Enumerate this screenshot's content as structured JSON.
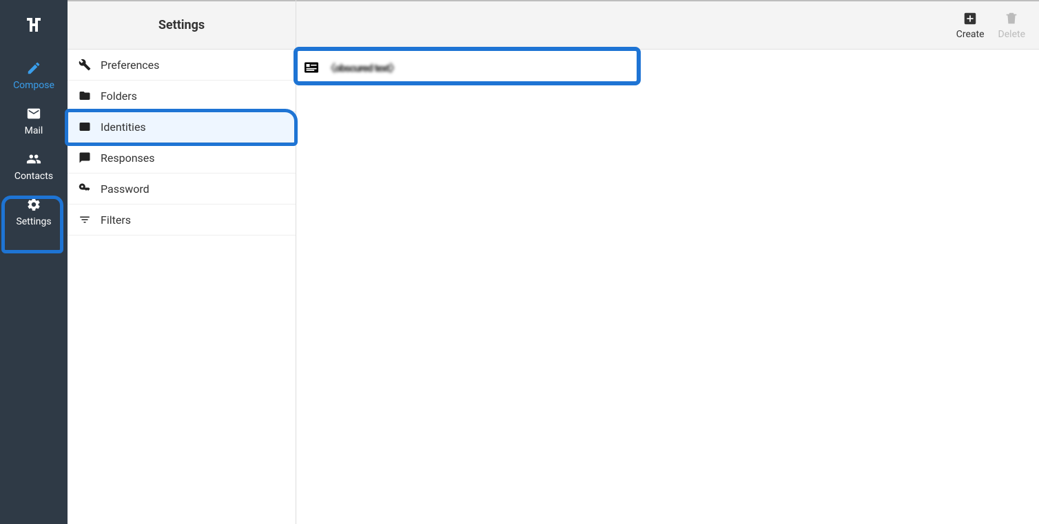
{
  "nav": {
    "compose": "Compose",
    "mail": "Mail",
    "contacts": "Contacts",
    "settings": "Settings"
  },
  "settings_header": "Settings",
  "settings_items": {
    "preferences": "Preferences",
    "folders": "Folders",
    "identities": "Identities",
    "responses": "Responses",
    "password": "Password",
    "filters": "Filters"
  },
  "toolbar": {
    "create": "Create",
    "delete": "Delete"
  },
  "identity_row_text": "〈obscured text〉"
}
